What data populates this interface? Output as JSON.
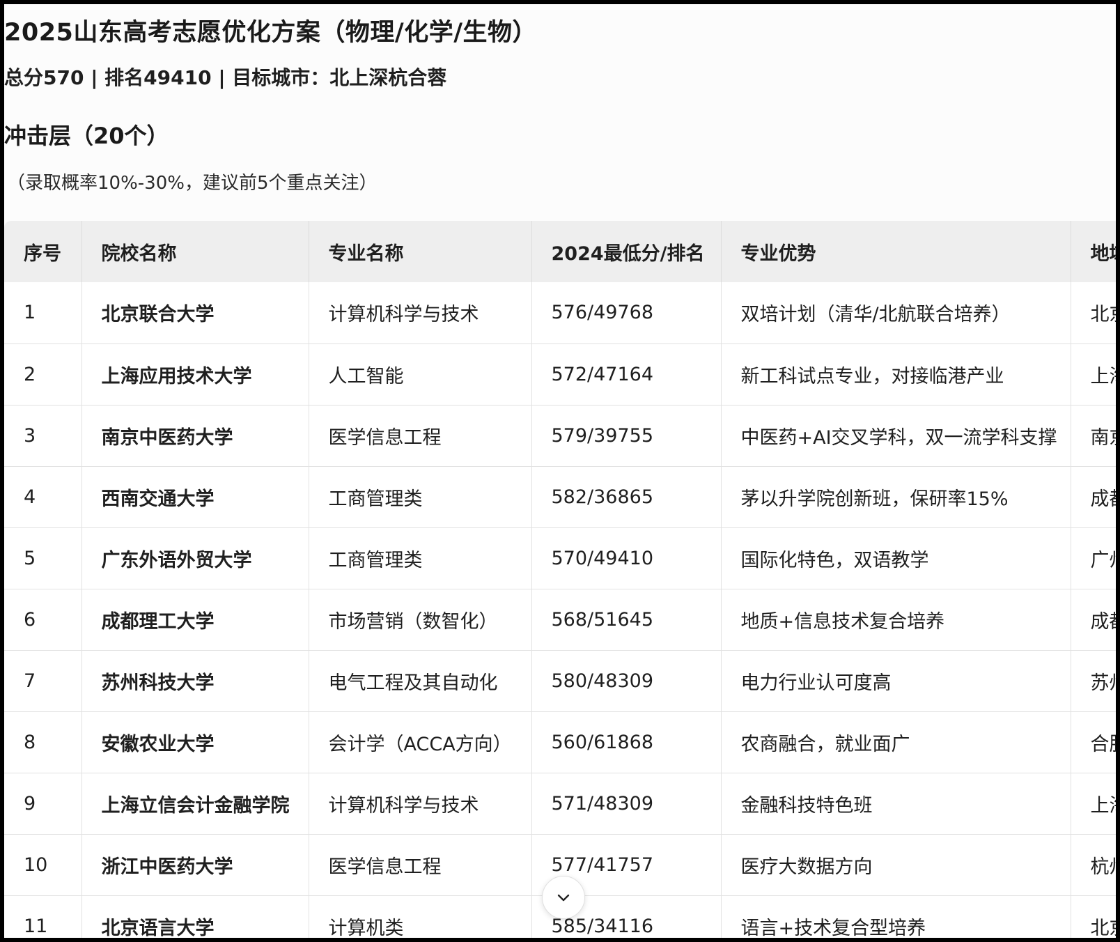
{
  "header": {
    "title": "2025山东高考志愿优化方案（物理/化学/生物）",
    "summary": "总分570 | 排名49410 | 目标城市：北上深杭合蓉"
  },
  "tier": {
    "heading": "冲击层（20个）",
    "note": "（录取概率10%-30%，建议前5个重点关注）"
  },
  "table": {
    "columns": [
      "序号",
      "院校名称",
      "专业名称",
      "2024最低分/排名",
      "专业优势",
      "地域"
    ],
    "rows": [
      {
        "idx": "1",
        "school": "北京联合大学",
        "major": "计算机科学与技术",
        "score": "576/49768",
        "advantage": "双培计划（清华/北航联合培养）",
        "location": "北京"
      },
      {
        "idx": "2",
        "school": "上海应用技术大学",
        "major": "人工智能",
        "score": "572/47164",
        "advantage": "新工科试点专业，对接临港产业",
        "location": "上海"
      },
      {
        "idx": "3",
        "school": "南京中医药大学",
        "major": "医学信息工程",
        "score": "579/39755",
        "advantage": "中医药+AI交叉学科，双一流学科支撑",
        "location": "南京"
      },
      {
        "idx": "4",
        "school": "西南交通大学",
        "major": "工商管理类",
        "score": "582/36865",
        "advantage": "茅以升学院创新班，保研率15%",
        "location": "成都"
      },
      {
        "idx": "5",
        "school": "广东外语外贸大学",
        "major": "工商管理类",
        "score": "570/49410",
        "advantage": "国际化特色，双语教学",
        "location": "广州"
      },
      {
        "idx": "6",
        "school": "成都理工大学",
        "major": "市场营销（数智化）",
        "score": "568/51645",
        "advantage": "地质+信息技术复合培养",
        "location": "成都"
      },
      {
        "idx": "7",
        "school": "苏州科技大学",
        "major": "电气工程及其自动化",
        "score": "580/48309",
        "advantage": "电力行业认可度高",
        "location": "苏州"
      },
      {
        "idx": "8",
        "school": "安徽农业大学",
        "major": "会计学（ACCA方向）",
        "score": "560/61868",
        "advantage": "农商融合，就业面广",
        "location": "合肥"
      },
      {
        "idx": "9",
        "school": "上海立信会计金融学院",
        "major": "计算机科学与技术",
        "score": "571/48309",
        "advantage": "金融科技特色班",
        "location": "上海"
      },
      {
        "idx": "10",
        "school": "浙江中医药大学",
        "major": "医学信息工程",
        "score": "577/41757",
        "advantage": "医疗大数据方向",
        "location": "杭州"
      },
      {
        "idx": "11",
        "school": "北京语言大学",
        "major": "计算机类",
        "score": "585/34116",
        "advantage": "语言+技术复合型培养",
        "location": "北京"
      }
    ]
  },
  "scroll_button": {
    "icon": "chevron-down-icon"
  }
}
